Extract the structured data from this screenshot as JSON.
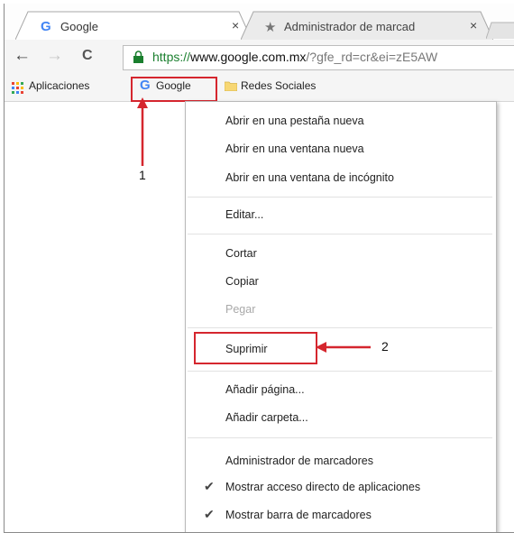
{
  "tabs": [
    {
      "title": "Google",
      "icon": "google-g-icon",
      "close": "×"
    },
    {
      "title": "Administrador de marcad",
      "icon": "star-icon",
      "close": "×"
    }
  ],
  "toolbar": {
    "back": "←",
    "forward": "→",
    "reload": "C",
    "url_https": "https://",
    "url_host": "www.google.com.mx",
    "url_rest": "/?gfe_rd=cr&ei=zE5AW"
  },
  "bookmarks": [
    {
      "label": "Aplicaciones",
      "icon": "apps-grid-icon"
    },
    {
      "label": "Google",
      "icon": "google-g-icon"
    },
    {
      "label": "Redes Sociales",
      "icon": "folder-icon"
    }
  ],
  "context_menu": {
    "items": [
      {
        "label": "Abrir en una pestaña nueva"
      },
      {
        "label": "Abrir en una ventana nueva"
      },
      {
        "label": "Abrir en una ventana de incógnito"
      },
      {
        "label": "Editar..."
      },
      {
        "label": "Cortar"
      },
      {
        "label": "Copiar"
      },
      {
        "label": "Pegar",
        "disabled": true
      },
      {
        "label": "Suprimir"
      },
      {
        "label": "Añadir página..."
      },
      {
        "label": "Añadir carpeta..."
      },
      {
        "label": "Administrador de marcadores"
      },
      {
        "label": "Mostrar acceso directo de aplicaciones",
        "checked": true
      },
      {
        "label": "Mostrar barra de marcadores",
        "checked": true
      }
    ]
  },
  "annotations": {
    "one": "1",
    "two": "2"
  },
  "colors": {
    "annotation_red": "#d5262e",
    "https_green": "#1a7f2e"
  }
}
